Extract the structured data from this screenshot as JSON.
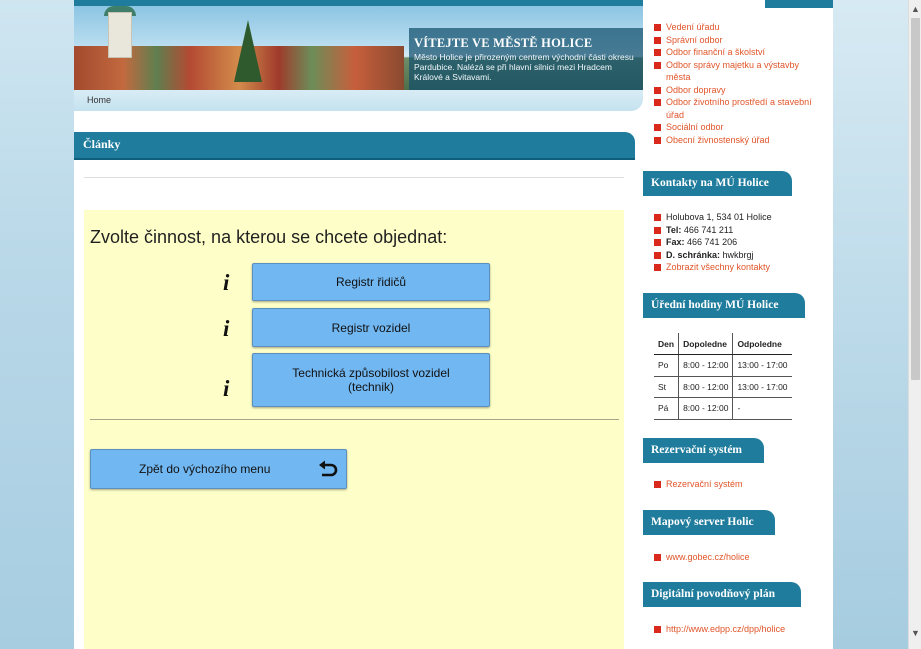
{
  "banner": {
    "welcome": "VÍTEJTE VE MĚSTĚ HOLICE",
    "intro": "Město Holice je přirozeným centrem východní části okresu Pardubice. Nalézá se při hlavní silnici mezi Hradcem Králové a Svitavami."
  },
  "breadcrumb": {
    "home": "Home"
  },
  "article": {
    "title": "Články"
  },
  "booking": {
    "heading": "Zvolte činnost, na kterou se chcete objednat:",
    "info_glyph": "i",
    "actions": [
      {
        "label": "Registr řidičů"
      },
      {
        "label": "Registr vozidel"
      },
      {
        "label": "Technická způsobilost vozidel (technik)"
      }
    ],
    "back_label": "Zpět do výchozího menu"
  },
  "sidebar": {
    "departments": [
      "Vedení úřadu",
      "Správní odbor",
      "Odbor finanční a školství",
      "Odbor správy majetku a výstavby města",
      "Odbor dopravy",
      "Odbor životního prostředí a stavební úřad",
      "Sociální odbor",
      "Obecní živnostenský úřad"
    ],
    "contacts": {
      "title": "Kontakty na MÚ Holice",
      "address": "Holubova 1, 534 01 Holice",
      "tel_label": "Tel:",
      "tel": "466 741 211",
      "fax_label": "Fax:",
      "fax": "466 741 206",
      "ds_label": "D. schránka:",
      "ds": "hwkbrgj",
      "all_link": "Zobrazit všechny kontakty"
    },
    "hours": {
      "title": "Úřední hodiny MÚ Holice",
      "headers": [
        "Den",
        "Dopoledne",
        "Odpoledne"
      ],
      "rows": [
        [
          "Po",
          "8:00 - 12:00",
          "13:00 - 17:00"
        ],
        [
          "St",
          "8:00 - 12:00",
          "13:00 - 17:00"
        ],
        [
          "Pá",
          "8:00 - 12:00",
          "-"
        ]
      ]
    },
    "reservation": {
      "title": "Rezervační systém",
      "link": "Rezervační systém"
    },
    "map": {
      "title": "Mapový server Holic",
      "link": "www.gobec.cz/holice"
    },
    "flood": {
      "title": "Digitální povodňový plán",
      "link": "http://www.edpp.cz/dpp/holice"
    }
  },
  "colors": {
    "accent": "#1f7c9c",
    "button": "#71b7f2",
    "booking_bg": "#feffc8",
    "link": "#e0552a",
    "bullet": "#d9281c"
  }
}
